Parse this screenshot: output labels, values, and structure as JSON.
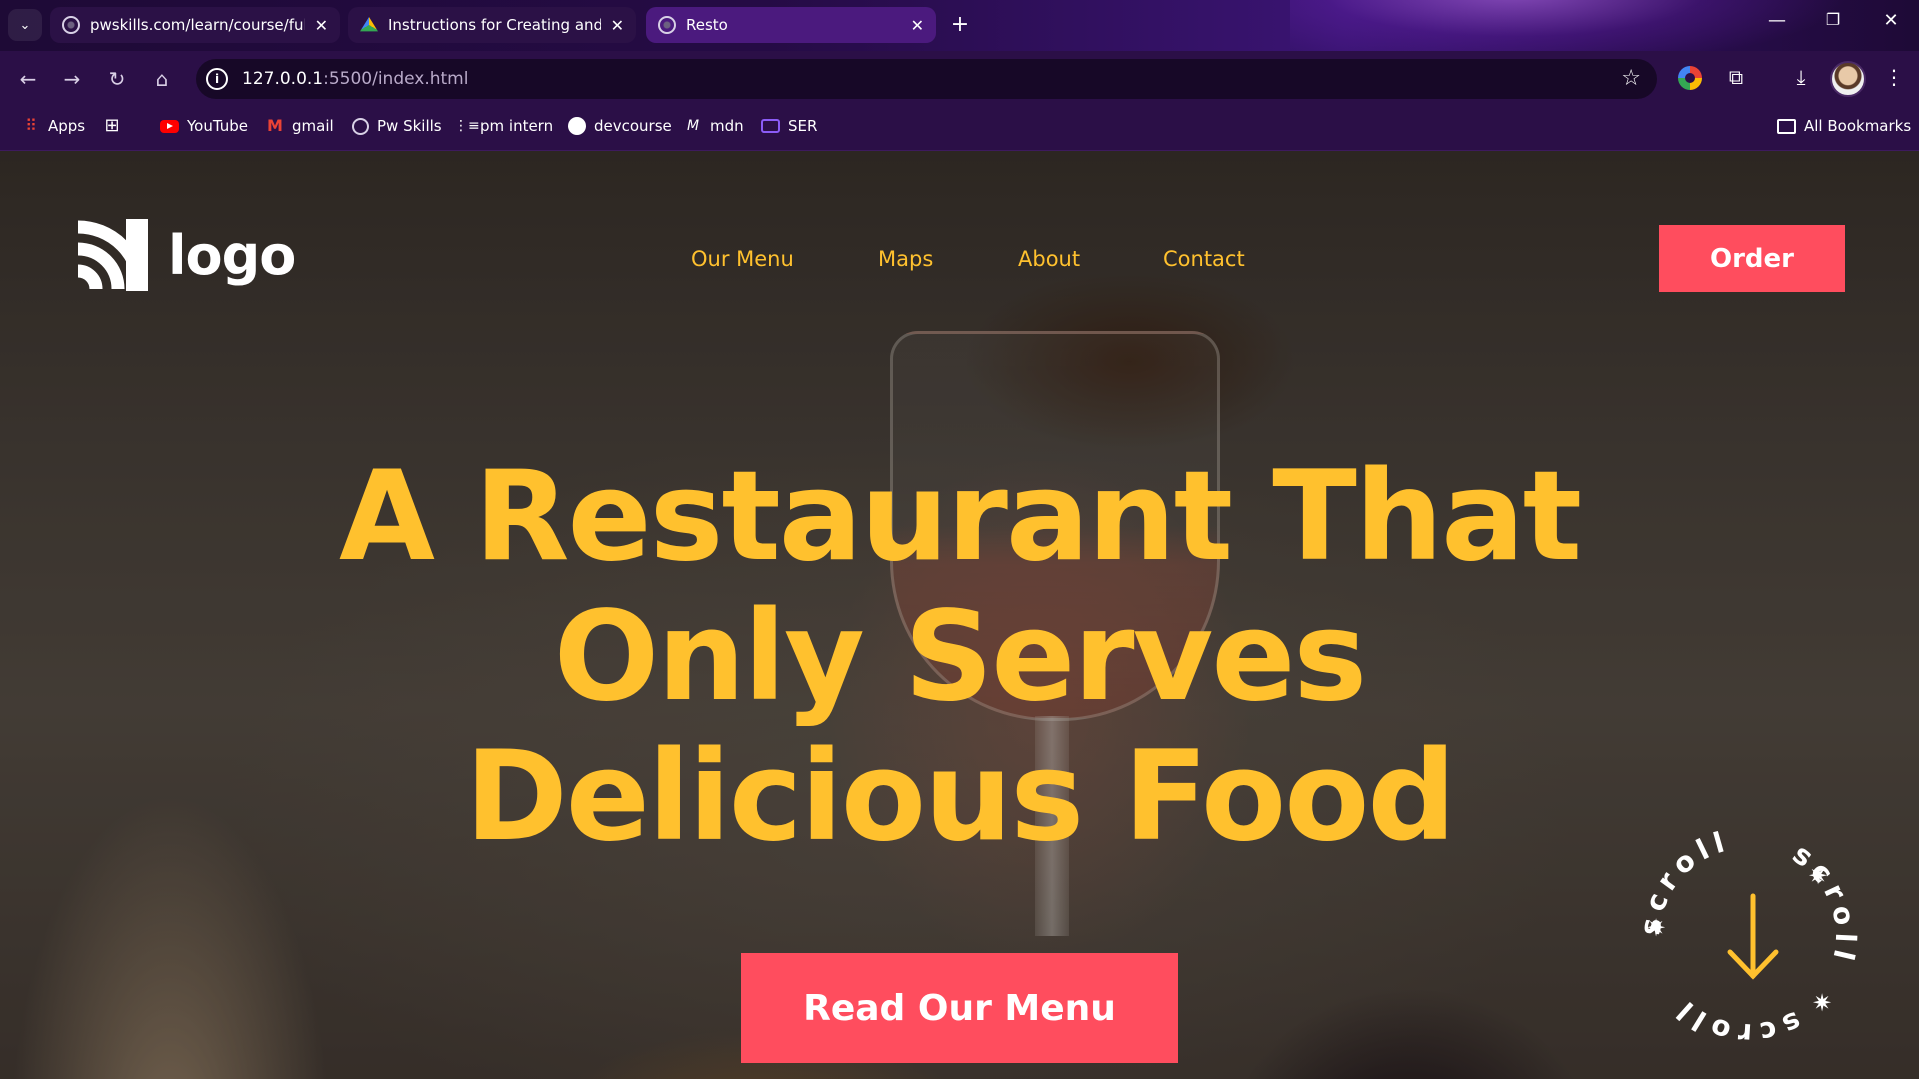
{
  "browser": {
    "tabs": [
      {
        "title": "pwskills.com/learn/course/full-s",
        "favicon": "globe-icon",
        "active": false
      },
      {
        "title": "Instructions for Creating and Su",
        "favicon": "google-drive-icon",
        "active": false
      },
      {
        "title": "Resto",
        "favicon": "globe-icon",
        "active": true
      }
    ],
    "url": {
      "host": "127.0.0.1",
      "path": ":5500/index.html"
    },
    "bookmarks": [
      {
        "label": "Apps",
        "icon": "apps-grid-icon"
      },
      {
        "label": "",
        "icon": "tab-groups-icon"
      },
      {
        "label": "YouTube",
        "icon": "youtube-icon"
      },
      {
        "label": "gmail",
        "icon": "gmail-icon"
      },
      {
        "label": "Pw Skills",
        "icon": "globe-icon"
      },
      {
        "label": "pm intern",
        "icon": "list-icon"
      },
      {
        "label": "devcourse",
        "icon": "github-icon"
      },
      {
        "label": "mdn",
        "icon": "mdn-icon"
      },
      {
        "label": "SER",
        "icon": "monitor-icon"
      }
    ],
    "all_bookmarks": "All Bookmarks",
    "accent": "#4b1a7e"
  },
  "page": {
    "logo_text": "logo",
    "nav": [
      "Our Menu",
      "Maps",
      "About",
      "Contact"
    ],
    "order_button": "Order",
    "hero_lines": [
      "A Restaurant That",
      "Only Serves",
      "Delicious Food"
    ],
    "cta_button": "Read Our Menu",
    "scroll_badge_text": "scroll",
    "colors": {
      "accent_yellow": "#ffc12e",
      "button_red": "#ff4d5e"
    }
  }
}
